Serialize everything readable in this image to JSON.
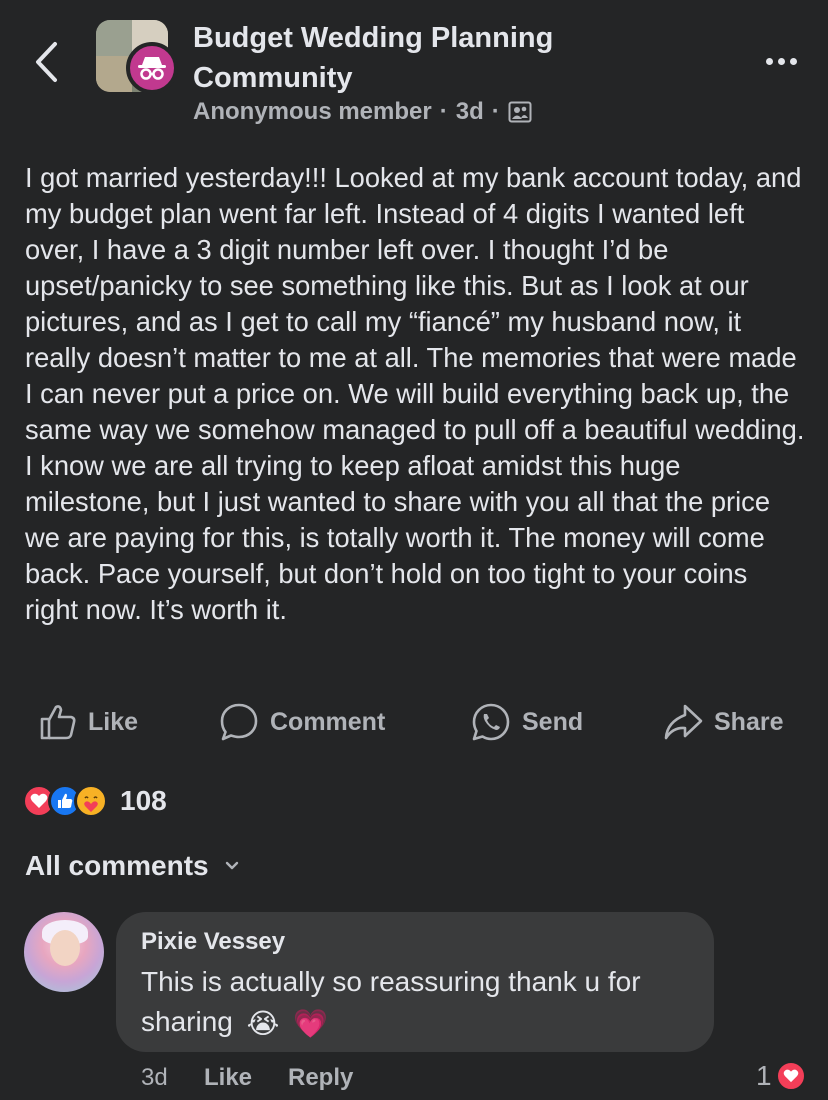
{
  "header": {
    "group_title": "Budget Wedding Planning Community",
    "author": "Anonymous member",
    "time": "3d",
    "separator": "·",
    "privacy_icon": "group-privacy-icon"
  },
  "post": {
    "text": "I got married yesterday!!! Looked at my bank account today, and my budget plan went far left. Instead of 4 digits I wanted left over, I have a 3 digit number left over. I thought I’d be upset/panicky to see something like this. But as I look at our pictures, and as I get to call my “fiancé” my husband now, it really doesn’t matter to me at all. The memories that were made I can never put a price on. We will build everything back up, the same way we somehow managed to pull off a beautiful wedding. I know we are all trying to keep afloat amidst this huge milestone, but I just wanted to share with you all that the price we are paying for this, is totally worth it. The money will come back. Pace yourself, but don’t hold on too tight to your coins right now. It’s worth it."
  },
  "actions": {
    "like": "Like",
    "comment": "Comment",
    "send": "Send",
    "share": "Share"
  },
  "reactions": {
    "count": "108",
    "types": [
      "love",
      "like",
      "care"
    ]
  },
  "comments_section": {
    "filter_label": "All comments"
  },
  "comment": {
    "author": "Pixie Vessey",
    "text": "This is actually so reassuring thank u for sharing",
    "emojis": [
      "😭",
      "💗"
    ],
    "time": "3d",
    "like": "Like",
    "reply": "Reply",
    "reaction_count": "1"
  },
  "colors": {
    "background": "#242526",
    "bubble": "#3a3b3c",
    "text": "#e4e6eb",
    "muted": "#b0b3b8",
    "anon_badge": "#c1398f",
    "love": "#f33e58",
    "like": "#1877f2"
  }
}
